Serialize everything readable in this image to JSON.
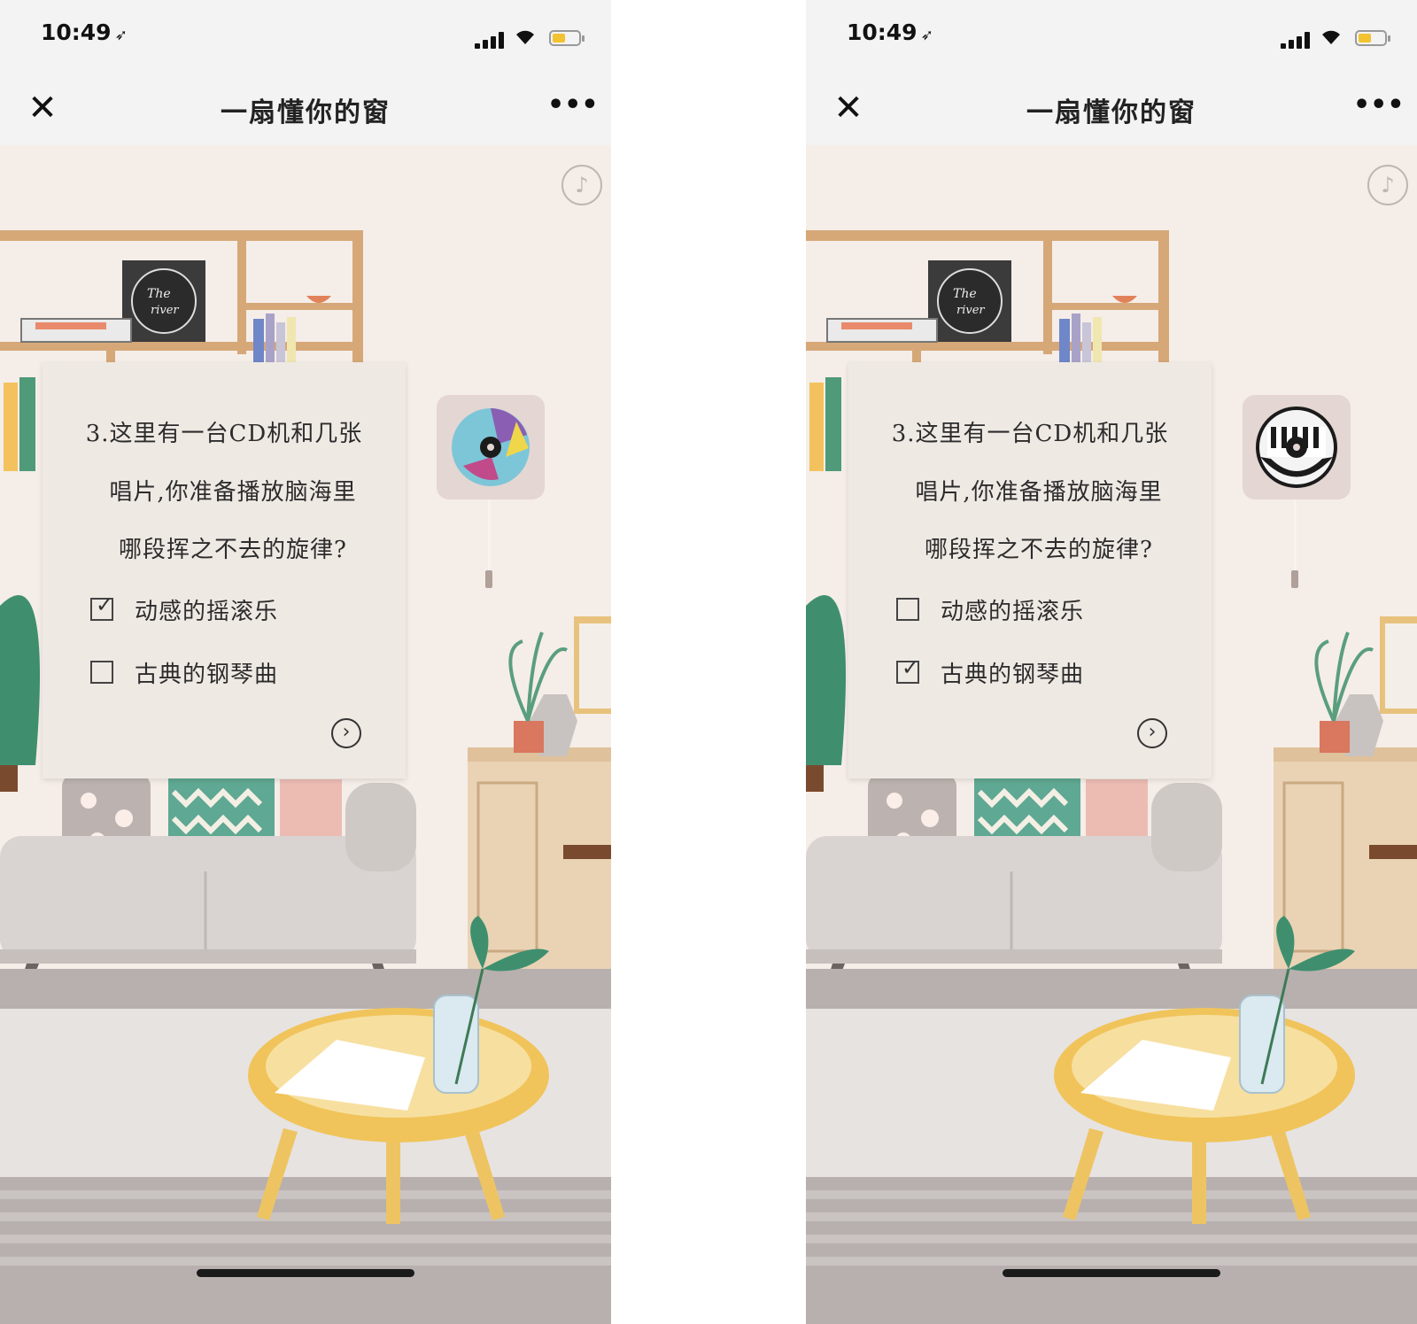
{
  "screens": [
    {
      "status": {
        "time": "10:49"
      },
      "nav": {
        "close": "✕",
        "title": "一扇懂你的窗",
        "more": "•••"
      },
      "music_icon": "music-note-icon",
      "question": {
        "line1": "3.这里有一台CD机和几张",
        "line2": "唱片,你准备播放脑海里",
        "line3": "哪段挥之不去的旋律?"
      },
      "options": [
        {
          "label": "动感的摇滚乐",
          "checked": true
        },
        {
          "label": "古典的钢琴曲",
          "checked": false
        }
      ],
      "album_text": "The river",
      "cd_style": "colorful"
    },
    {
      "status": {
        "time": "10:49"
      },
      "nav": {
        "close": "✕",
        "title": "一扇懂你的窗",
        "more": "•••"
      },
      "music_icon": "music-note-icon",
      "question": {
        "line1": "3.这里有一台CD机和几张",
        "line2": "唱片,你准备播放脑海里",
        "line3": "哪段挥之不去的旋律?"
      },
      "options": [
        {
          "label": "动感的摇滚乐",
          "checked": false
        },
        {
          "label": "古典的钢琴曲",
          "checked": true
        }
      ],
      "album_text": "The river",
      "cd_style": "piano"
    }
  ],
  "colors": {
    "wall": "#f5ede8",
    "shelf": "#d6a878",
    "sofa": "#d9d4d1",
    "floor": "#b7b0ae",
    "rug": "#e7e3e1",
    "table": "#eec463",
    "cabinet": "#ead3b5",
    "plant": "#3f8f6f"
  }
}
